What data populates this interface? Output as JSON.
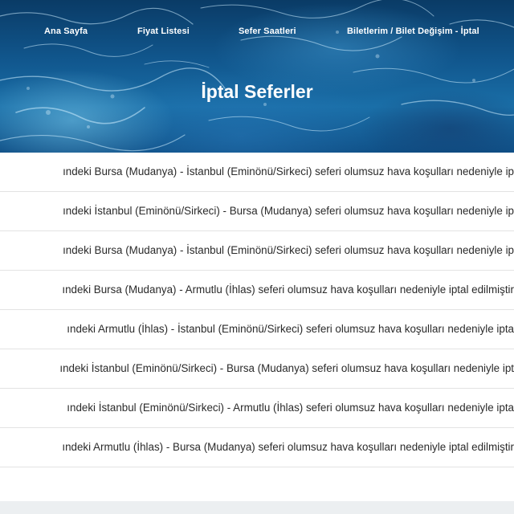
{
  "nav": {
    "items": [
      "Ana Sayfa",
      "Fiyat Listesi",
      "Sefer Saatleri",
      "Biletlerim / Bilet Değişim - İptal"
    ]
  },
  "page": {
    "title": "İptal Seferler"
  },
  "cancellations": [
    "ındeki Bursa (Mudanya) - İstanbul (Eminönü/Sirkeci) seferi olumsuz hava koşulları nedeniyle ip",
    "ındeki İstanbul (Eminönü/Sirkeci) - Bursa (Mudanya) seferi olumsuz hava koşulları nedeniyle ip",
    "ındeki Bursa (Mudanya) - İstanbul (Eminönü/Sirkeci) seferi olumsuz hava koşulları nedeniyle ip",
    "ındeki Bursa (Mudanya) - Armutlu (İhlas) seferi olumsuz hava koşulları nedeniyle iptal edilmiştir",
    "ındeki Armutlu (İhlas) - İstanbul (Eminönü/Sirkeci) seferi olumsuz hava koşulları nedeniyle ipta",
    "ındeki İstanbul (Eminönü/Sirkeci) - Bursa (Mudanya) seferi olumsuz hava koşulları nedeniyle ipt",
    "ındeki İstanbul (Eminönü/Sirkeci) - Armutlu (İhlas) seferi olumsuz hava koşulları nedeniyle ipta",
    "ındeki Armutlu (İhlas) - Bursa (Mudanya) seferi olumsuz hava koşulları nedeniyle iptal edilmiştir"
  ]
}
